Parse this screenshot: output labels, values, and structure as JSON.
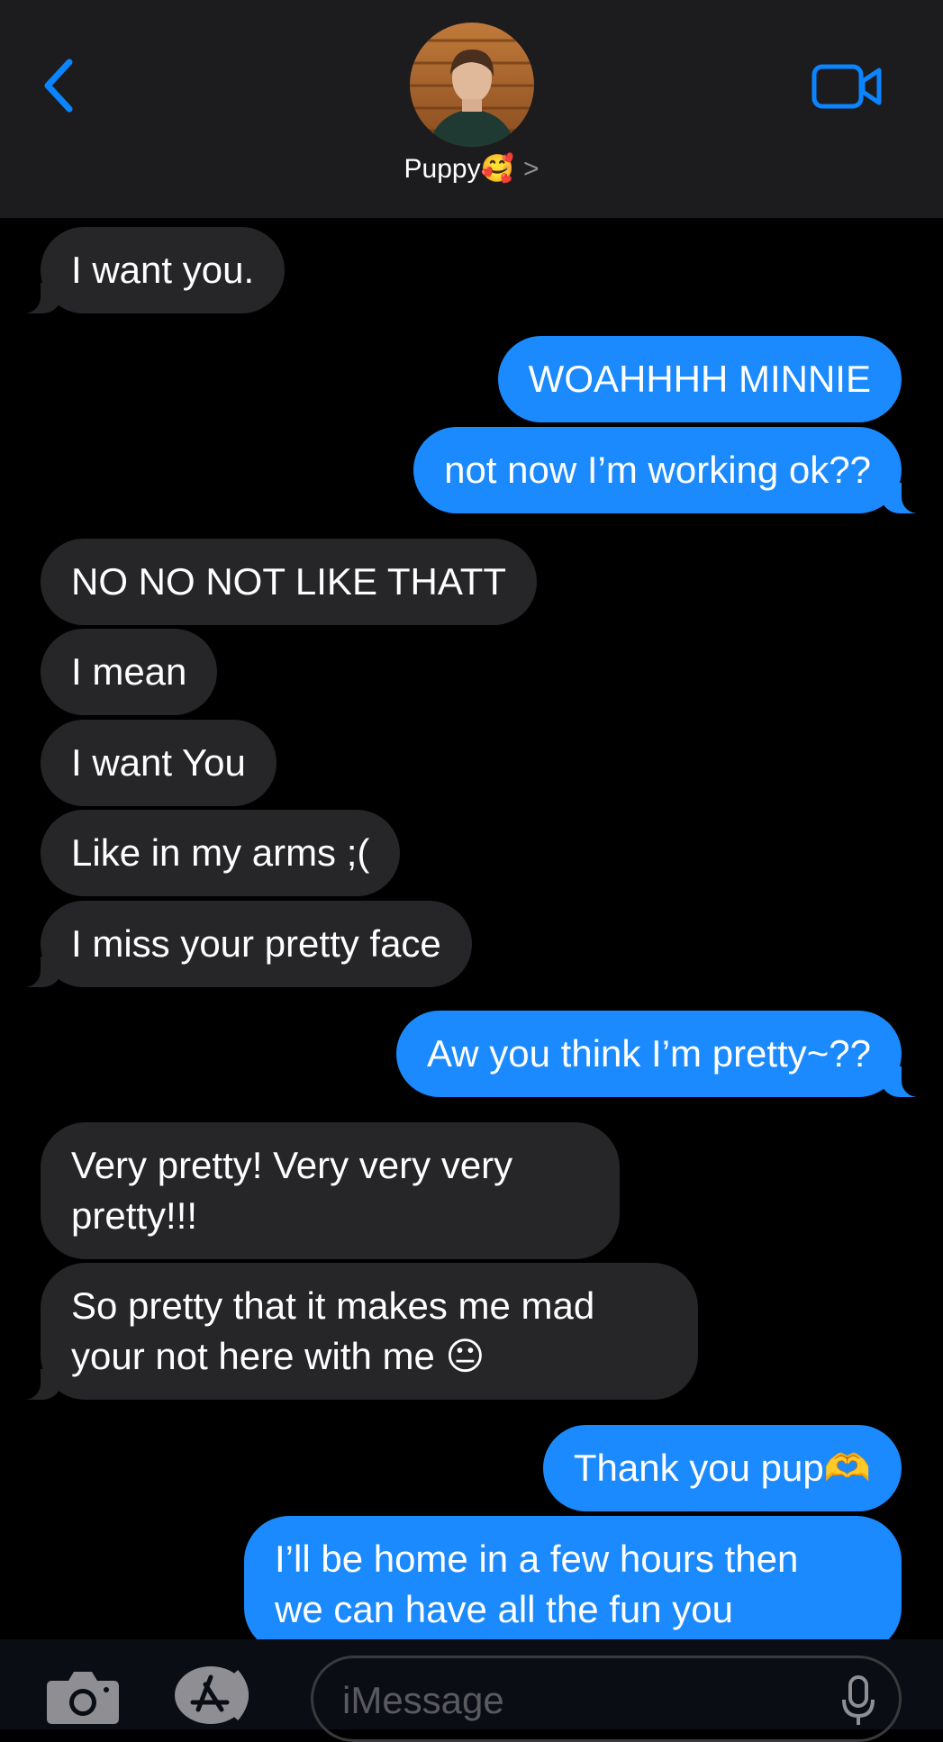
{
  "header": {
    "contact_name": "Puppy🥰",
    "chevron": ">"
  },
  "messages": [
    {
      "id": "m1",
      "from": "them",
      "text": "I want you."
    },
    {
      "id": "m2",
      "from": "me",
      "text": "WOAHHHH MINNIE"
    },
    {
      "id": "m3",
      "from": "me",
      "text": "not now I’m working ok??"
    },
    {
      "id": "m4",
      "from": "them",
      "text": "NO NO NOT LIKE THATT"
    },
    {
      "id": "m5",
      "from": "them",
      "text": "I mean"
    },
    {
      "id": "m6",
      "from": "them",
      "text": "I want You"
    },
    {
      "id": "m7",
      "from": "them",
      "text": "Like in my arms ;("
    },
    {
      "id": "m8",
      "from": "them",
      "text": "I miss your pretty face"
    },
    {
      "id": "m9",
      "from": "me",
      "text": "Aw you think I’m pretty~??"
    },
    {
      "id": "m10",
      "from": "them",
      "line1": "Very pretty! Very very very",
      "line2": "pretty!!!"
    },
    {
      "id": "m11",
      "from": "them",
      "line1": "So pretty that it makes me mad",
      "line2": "your not here with me 😐"
    },
    {
      "id": "m12",
      "from": "me",
      "text": "Thank you pup🫶"
    },
    {
      "id": "m13",
      "from": "me",
      "line1": "I’ll be home in a few hours then",
      "line2": "we can have all the fun you"
    }
  ],
  "composer": {
    "placeholder": "iMessage"
  },
  "icons": {
    "back": "chevron-left-icon",
    "video": "video-camera-icon",
    "camera": "camera-icon",
    "apps": "app-store-icon",
    "mic": "microphone-icon"
  },
  "colors": {
    "sent_bubble": "#1b8afe",
    "received_bubble": "#262629",
    "accent": "#0a84ff",
    "header_bg": "#1c1c1e",
    "background": "#000000"
  }
}
